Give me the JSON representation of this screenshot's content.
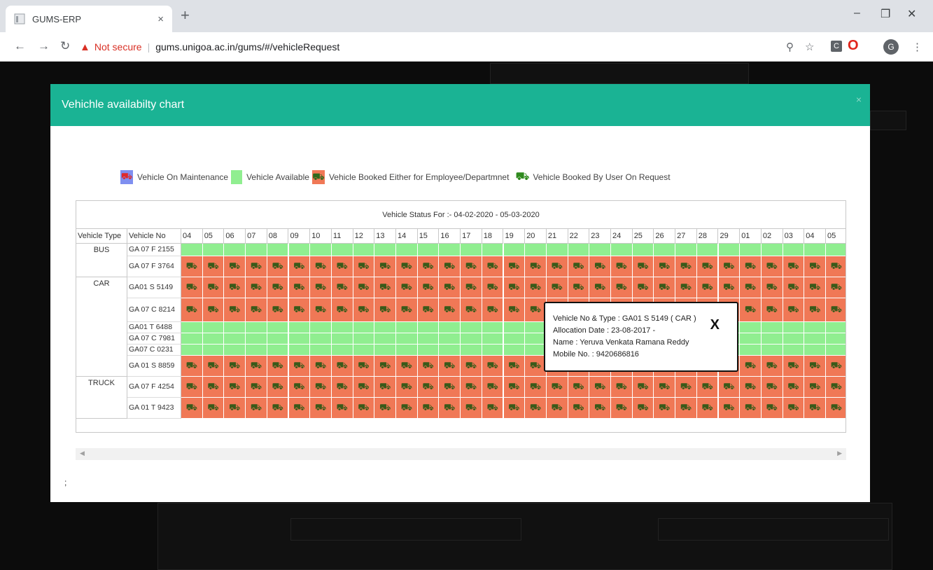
{
  "browser": {
    "tab_title": "GUMS-ERP",
    "tab_close": "×",
    "new_tab": "+",
    "address_warning": "Not secure",
    "address_sep": "|",
    "url": "gums.unigoa.ac.in/gums/#/vehicleRequest",
    "avatar_letter": "G",
    "ext_letter": "C"
  },
  "modal": {
    "title": "Vehichle availabilty chart",
    "close_label": "×"
  },
  "legend": {
    "maintenance": "Vehicle On Maintenance",
    "available": "Vehicle Available",
    "booked": "Vehicle Booked Either for Employee/Departmnet",
    "user_request": "Vehicle Booked By User On Request"
  },
  "chart_data": {
    "type": "table",
    "title": "Vehicle Status For :- 04-02-2020 - 05-03-2020",
    "column_headers": [
      "Vehicle Type",
      "Vehicle No"
    ],
    "dates": [
      "04",
      "05",
      "06",
      "07",
      "08",
      "09",
      "10",
      "11",
      "12",
      "13",
      "14",
      "15",
      "16",
      "17",
      "18",
      "19",
      "20",
      "21",
      "22",
      "23",
      "24",
      "25",
      "26",
      "27",
      "28",
      "29",
      "01",
      "02",
      "03",
      "04",
      "05"
    ],
    "rows": [
      {
        "type": "BUS",
        "vehicle_no": "GA 07 F 2155",
        "status": "available"
      },
      {
        "type": "",
        "vehicle_no": "GA 07 F 3764",
        "status": "booked"
      },
      {
        "type": "CAR",
        "vehicle_no": "GA01 S 5149",
        "status": "booked"
      },
      {
        "type": "",
        "vehicle_no": "GA 07 C 8214",
        "status": "booked"
      },
      {
        "type": "",
        "vehicle_no": "GA01 T 6488",
        "status": "available"
      },
      {
        "type": "",
        "vehicle_no": "GA 07 C 7981",
        "status": "available"
      },
      {
        "type": "",
        "vehicle_no": "GA07 C 0231",
        "status": "available"
      },
      {
        "type": "",
        "vehicle_no": "GA 01 S 8859",
        "status": "booked"
      },
      {
        "type": "TRUCK",
        "vehicle_no": "GA 07 F 4254",
        "status": "booked"
      },
      {
        "type": "",
        "vehicle_no": "GA 01 T 9423",
        "status": "booked"
      }
    ],
    "status_colors": {
      "available": "#90ee90",
      "booked": "#f07856",
      "maintenance": "#7f8ff0"
    }
  },
  "popup": {
    "line1": "Vehicle No & Type : GA01 S 5149 ( CAR )",
    "line2": "Allocation Date : 23-08-2017 -",
    "line3": "Name : Yeruva Venkata Ramana Reddy",
    "line4": "Mobile No. : 9420686816",
    "close_label": "X"
  },
  "footer_text": ";",
  "colors": {
    "header": "#1ab394"
  }
}
